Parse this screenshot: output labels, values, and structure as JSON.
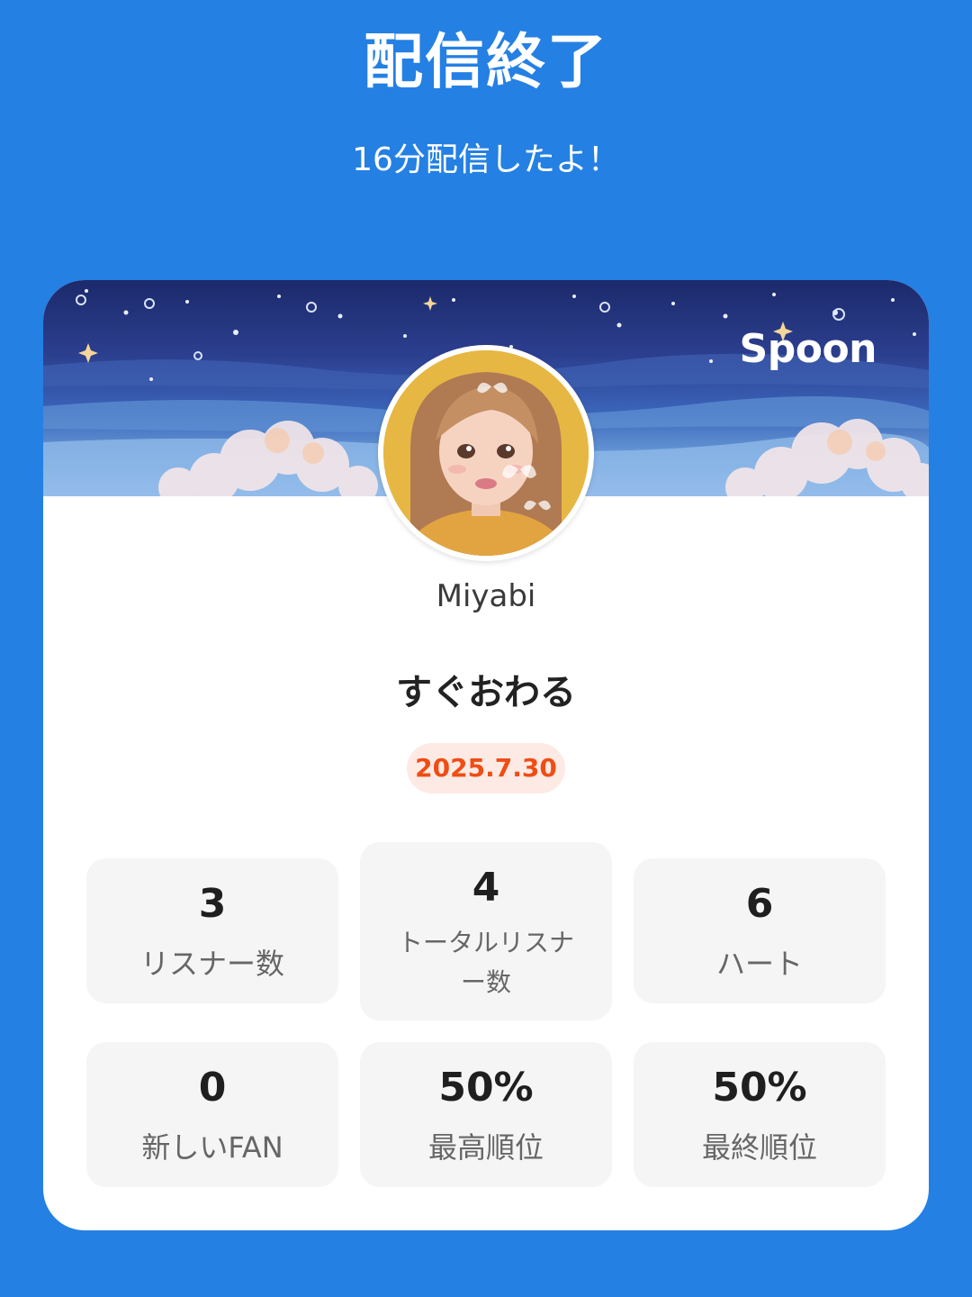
{
  "header": {
    "title": "配信終了",
    "subtitle": "16分配信したよ！"
  },
  "card": {
    "brand": "Spoon",
    "username": "Miyabi",
    "live_title": "すぐおわる",
    "date": "2025.7.30",
    "stats": [
      {
        "value": "3",
        "label": "リスナー数"
      },
      {
        "value": "4",
        "label": "トータルリスナー数"
      },
      {
        "value": "6",
        "label": "ハート"
      },
      {
        "value": "0",
        "label": "新しいFAN"
      },
      {
        "value": "50%",
        "label": "最高順位"
      },
      {
        "value": "50%",
        "label": "最終順位"
      }
    ]
  },
  "colors": {
    "background": "#2480e3",
    "date_badge_bg": "#fdeae4",
    "date_badge_text": "#f04d14",
    "stat_box_bg": "#f5f5f5"
  },
  "icons": {
    "banner": "night-sky-illustration",
    "avatar": "profile-avatar-illustration"
  }
}
